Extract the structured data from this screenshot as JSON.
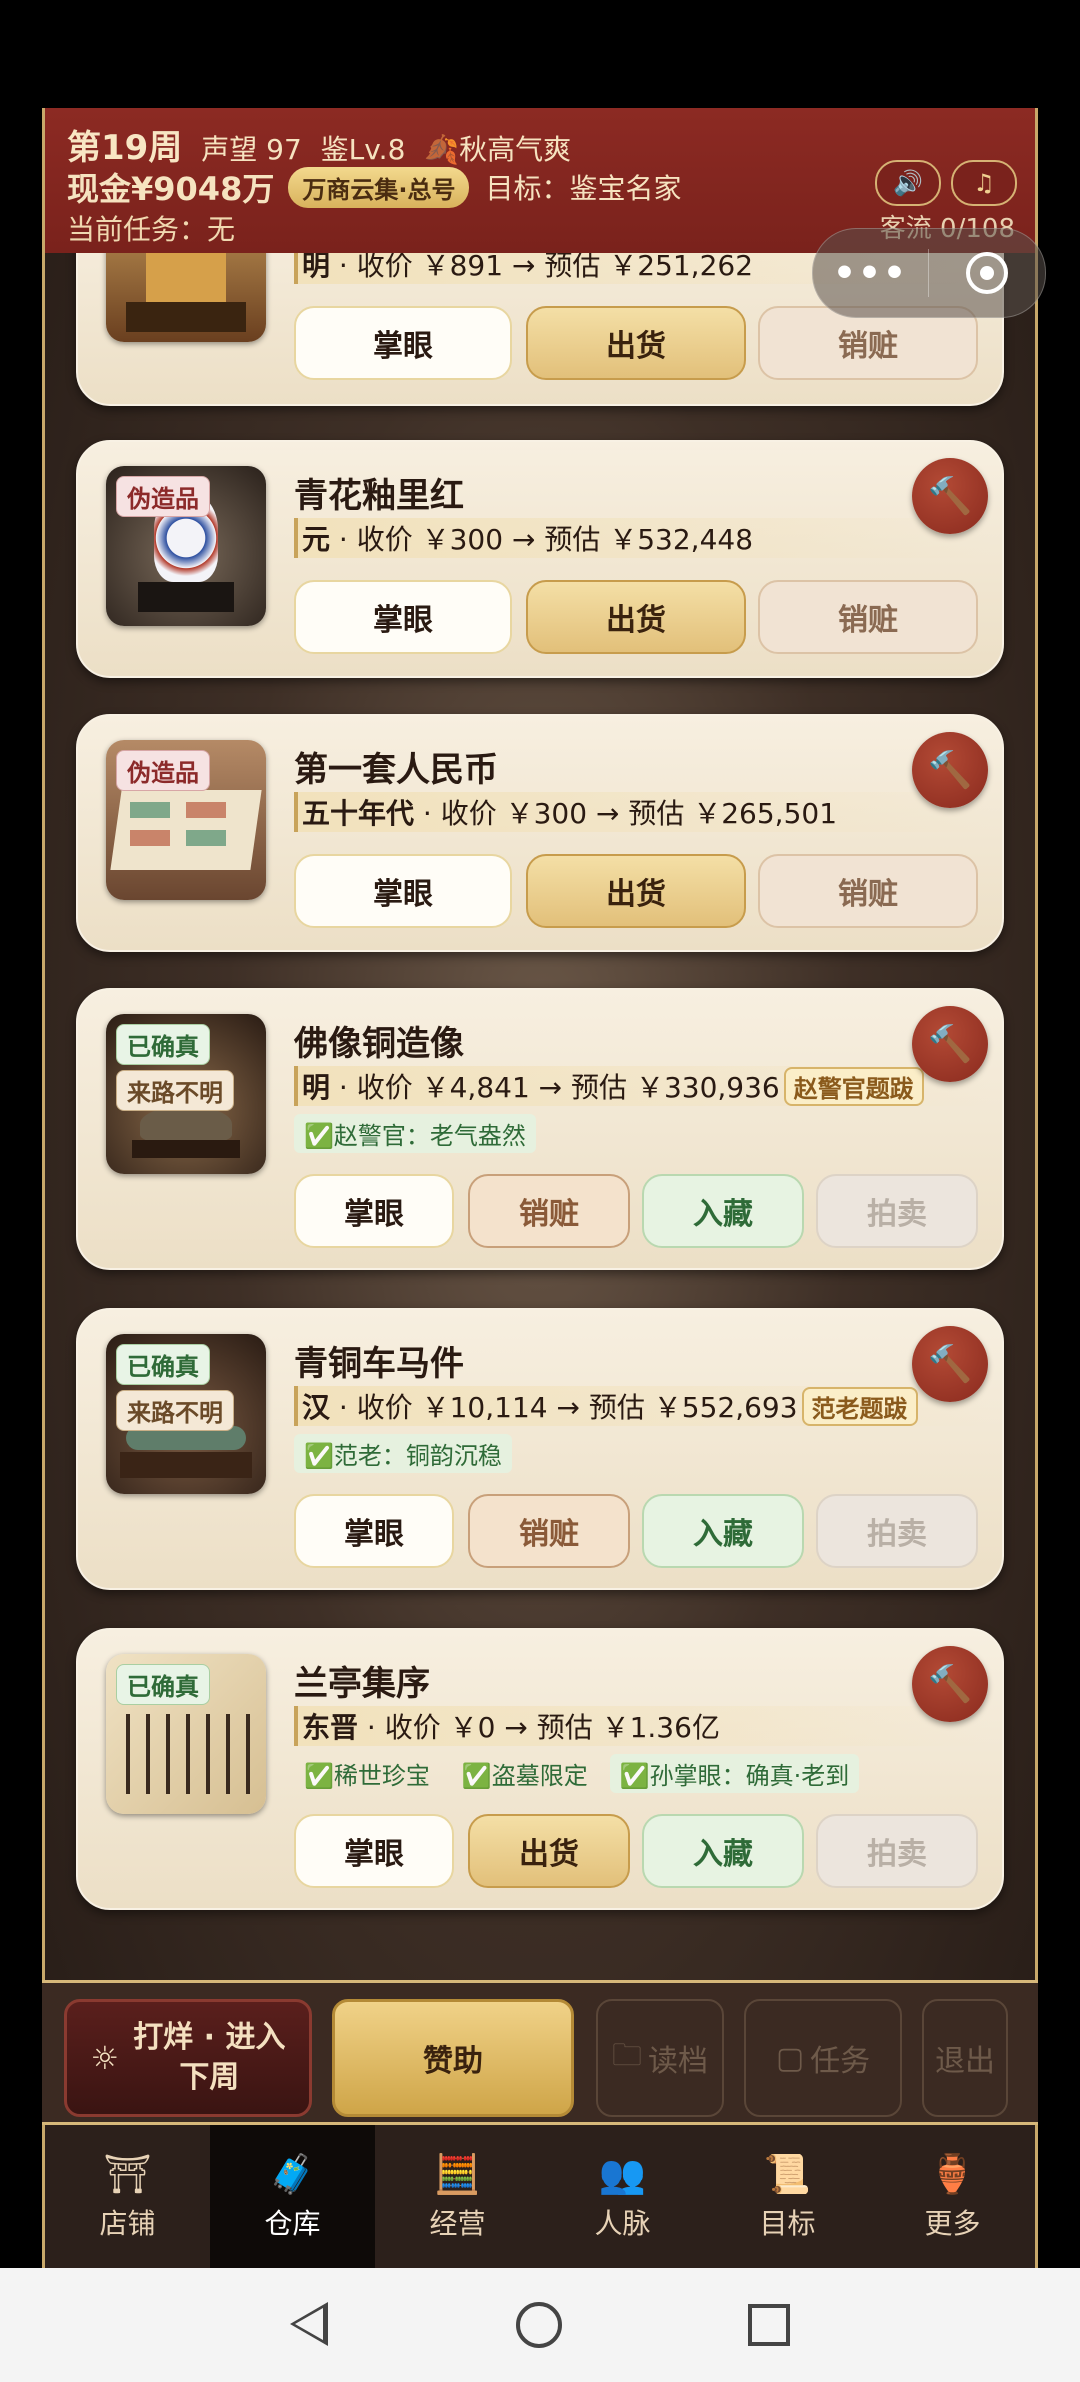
{
  "header": {
    "week": "第19周",
    "reputation": "声望 97",
    "level": "鉴Lv.8",
    "season": "秋高气爽",
    "cash": "现金¥9048万",
    "badge": "万商云集·总号",
    "goal": "目标：鉴宝名家",
    "task": "当前任务：无",
    "visitors": "客流 0/108",
    "sound_icon": "speaker-icon",
    "music_icon": "music-note-icon"
  },
  "capsule": {
    "dots": "•••"
  },
  "cards": [
    {
      "name": "",
      "info": {
        "era": "明",
        "rest": " · 收价 ￥891 → 预估 ￥251,262"
      },
      "buttons": [
        "掌眼",
        "出货",
        "销赃"
      ]
    },
    {
      "name": "青花釉里红",
      "tags": [
        "伪造品"
      ],
      "info": {
        "era": "元",
        "rest": " · 收价 ￥300 → 预估 ￥532,448"
      },
      "buttons": [
        "掌眼",
        "出货",
        "销赃"
      ]
    },
    {
      "name": "第一套人民币",
      "tags": [
        "伪造品"
      ],
      "info": {
        "era": "五十年代",
        "rest": " · 收价 ￥300 → 预估 ￥265,501"
      },
      "buttons": [
        "掌眼",
        "出货",
        "销赃"
      ]
    },
    {
      "name": "佛像铜造像",
      "tags": [
        "已确真",
        "来路不明"
      ],
      "info": {
        "era": "明",
        "rest": " · 收价 ￥4,841 → 预估 ￥330,936"
      },
      "stamp": "赵警官题跋",
      "notes": [
        "✅赵警官：老气盎然"
      ],
      "buttons": [
        "掌眼",
        "销赃",
        "入藏",
        "拍卖"
      ]
    },
    {
      "name": "青铜车马件",
      "tags": [
        "已确真",
        "来路不明"
      ],
      "info": {
        "era": "汉",
        "rest": " · 收价 ￥10,114 → 预估 ￥552,693"
      },
      "stamp": "范老题跋",
      "notes": [
        "✅范老：铜韵沉稳"
      ],
      "buttons": [
        "掌眼",
        "销赃",
        "入藏",
        "拍卖"
      ]
    },
    {
      "name": "兰亭集序",
      "tags": [
        "已确真"
      ],
      "info": {
        "era": "东晋",
        "rest": " · 收价 ￥0 → 预估 ￥1.36亿"
      },
      "notes": [
        "✅稀世珍宝",
        "✅盗墓限定",
        "✅孙掌眼：确真·老到"
      ],
      "buttons": [
        "掌眼",
        "出货",
        "入藏",
        "拍卖"
      ]
    }
  ],
  "actions": {
    "next_week_line1": "打烊 · 进入",
    "next_week_line2": "下周",
    "sponsor": "赞助",
    "load": "读档",
    "tasks": "任务",
    "exit": "退出"
  },
  "tabs": [
    {
      "label": "店铺",
      "icon": "shop-icon"
    },
    {
      "label": "仓库",
      "icon": "warehouse-chest-icon"
    },
    {
      "label": "经营",
      "icon": "ledger-icon"
    },
    {
      "label": "人脉",
      "icon": "people-icon"
    },
    {
      "label": "目标",
      "icon": "scroll-icon"
    },
    {
      "label": "更多",
      "icon": "more-icon"
    }
  ],
  "colors": {
    "header_red": "#7a221c",
    "gold": "#d8b25c",
    "card_bg": "#f3ead8",
    "hammer_red": "#9a3424"
  }
}
